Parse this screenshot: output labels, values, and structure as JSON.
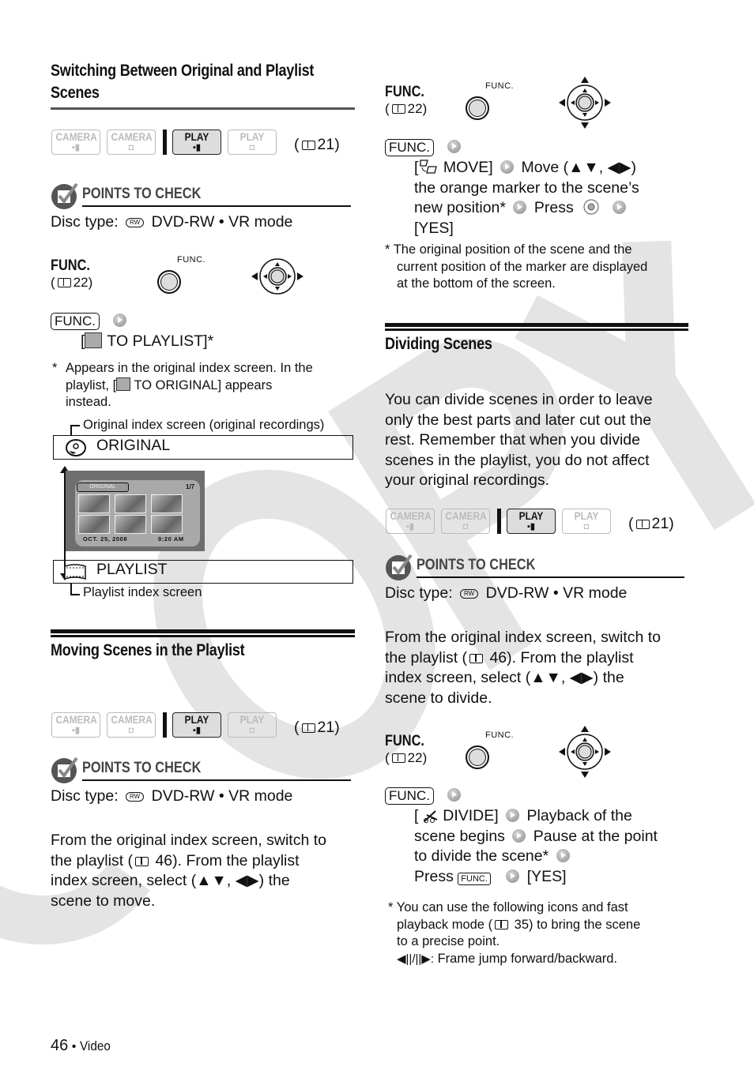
{
  "watermark": "COPY",
  "left_column": {
    "section1": {
      "title_line1": "Switching Between Original and Playlist",
      "title_line2": "Scenes",
      "modes": [
        {
          "line1": "CAMERA",
          "icon": "movie-camera-icon",
          "active": false
        },
        {
          "line1": "CAMERA",
          "icon": "still-camera-icon",
          "active": false
        },
        {
          "line1": "PLAY",
          "icon": "movie-camera-icon",
          "active": true
        },
        {
          "line1": "PLAY",
          "icon": "still-camera-icon",
          "active": false
        }
      ],
      "mode_ref": "21",
      "points_to_check": "POINTS TO CHECK",
      "disc_type_label": "Disc type:",
      "disc_type_value": "DVD-RW • VR mode",
      "disc_icon_text": "RW",
      "func_label": "FUNC.",
      "func_ref": "22",
      "func_button_caption": "FUNC.",
      "func_key": "FUNC.",
      "step": "TO PLAYLIST]*",
      "step_prefix": "[",
      "footnote_star": "*",
      "footnote_line1": "Appears in the original index screen. In the",
      "footnote_line2a": "playlist, [",
      "footnote_line2b": " TO ORIGINAL] appears",
      "footnote_line3": "instead.",
      "diagram": {
        "top_caption": "Original index screen (original recordings)",
        "original_label": "ORIGINAL",
        "screen_badge": "ORIGINAL",
        "screen_page": "1/7",
        "screen_date": "OCT. 25, 2008",
        "screen_time": "9:20 AM",
        "playlist_label": "PLAYLIST",
        "bottom_caption": "Playlist index screen"
      }
    },
    "section2": {
      "title": "Moving Scenes in the Playlist",
      "mode_ref": "21",
      "points_to_check": "POINTS TO CHECK",
      "disc_type_label": "Disc type:",
      "disc_type_value": "DVD-RW • VR mode",
      "body_line1": "From the original index screen, switch to",
      "body_line2a": "the playlist (",
      "body_line2b": " 46). From the playlist",
      "body_line3": "index screen, select (▲▼, ◀▶) the",
      "body_line4": "scene to move."
    }
  },
  "right_column": {
    "move_steps": {
      "func_label": "FUNC.",
      "func_ref": "22",
      "func_button_caption": "FUNC.",
      "func_key": "FUNC.",
      "line1a": "[",
      "line1b": " MOVE]",
      "line1c": "Move (▲▼, ◀▶)",
      "line2": "the orange marker to the scene’s",
      "line3a": "new position*",
      "line3b": "Press",
      "line4": "[YES]",
      "footnote_line1": "* The original position of the scene and the",
      "footnote_line2": "current position of the marker are displayed",
      "footnote_line3": "at the bottom of the screen."
    },
    "section3": {
      "title": "Dividing Scenes",
      "intro": [
        "You can divide scenes in order to leave",
        "only the best parts and later cut out the",
        "rest. Remember that when you divide",
        "scenes in the playlist, you do not affect",
        "your original recordings."
      ],
      "mode_ref": "21",
      "points_to_check": "POINTS TO CHECK",
      "disc_type_label": "Disc type:",
      "disc_type_value": "DVD-RW • VR mode",
      "body_line1": "From the original index screen, switch to",
      "body_line2a": "the playlist (",
      "body_line2b": " 46). From the playlist",
      "body_line3": "index screen, select (▲▼, ◀▶) the",
      "body_line4": "scene to divide.",
      "func_label": "FUNC.",
      "func_ref": "22",
      "func_button_caption": "FUNC.",
      "func_key": "FUNC.",
      "step_line1a": "[",
      "step_line1b": " DIVIDE]",
      "step_line1c": "Playback of the",
      "step_line2a": "scene begins",
      "step_line2b": "Pause at the point",
      "step_line3": "to divide the scene*",
      "step_line4a": "Press",
      "step_line4_key": "FUNC.",
      "step_line4b": "[YES]",
      "footnote_line1": "* You can use the following icons and fast",
      "footnote_line2a": "playback mode (",
      "footnote_line2b": " 35) to bring the scene",
      "footnote_line3": "to a precise point.",
      "footnote_line4_icons": "◀||/||▶:",
      "footnote_line4": "Frame jump forward/backward."
    }
  },
  "footer": {
    "page_number": "46",
    "bullet": "•",
    "section": "Video"
  }
}
